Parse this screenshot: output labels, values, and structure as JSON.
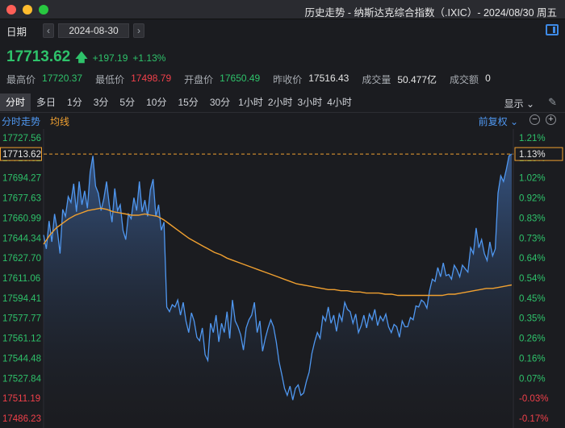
{
  "window": {
    "title": "历史走势 - 纳斯达克综合指数（.IXIC）- 2024/08/30 周五",
    "traffic_lights": [
      "#fe5f57",
      "#febc2e",
      "#28c840"
    ]
  },
  "date_bar": {
    "label": "日期",
    "prev_icon": "chevron-left-icon",
    "prev_glyph": "‹",
    "date": "2024-08-30",
    "next_icon": "chevron-right-icon",
    "next_glyph": "›",
    "panel_icon": "side-panel-icon"
  },
  "quote": {
    "price": "17713.62",
    "arrow": "🡅",
    "change": "+197.19",
    "change_pct": "+1.13%",
    "stats": [
      {
        "label": "最高价",
        "value": "17720.37",
        "color": "green"
      },
      {
        "label": "最低价",
        "value": "17498.79",
        "color": "red"
      },
      {
        "label": "开盘价",
        "value": "17650.49",
        "color": "green"
      },
      {
        "label": "昨收价",
        "value": "17516.43",
        "color": "white"
      },
      {
        "label": "成交量",
        "value": "50.477亿",
        "color": "white"
      },
      {
        "label": "成交额",
        "value": "0",
        "color": "white"
      }
    ]
  },
  "periods": {
    "tabs": [
      "分时",
      "多日",
      "1分",
      "3分",
      "5分",
      "10分",
      "15分",
      "30分",
      "1小时",
      "2小时",
      "3小时",
      "4小时"
    ],
    "active": "分时",
    "show_label": "显示",
    "show_arrow": "⌄",
    "settings_icon": "wrench-icon",
    "settings_glyph": "✎"
  },
  "chart_legend": {
    "intraday": "分时走势",
    "average": "均线",
    "adjust": "前复权",
    "adjust_arrow": "⌄",
    "zoom_out": "−",
    "zoom_in": "+"
  },
  "chart_data": {
    "type": "area",
    "y_labels_left": [
      "17727.56",
      "17713.62",
      "17694.27",
      "17677.63",
      "17660.99",
      "17644.34",
      "17627.70",
      "17611.06",
      "17594.41",
      "17577.77",
      "17561.12",
      "17544.48",
      "17527.84",
      "17511.19",
      "17486.23"
    ],
    "y_labels_right": [
      "1.21%",
      "1.13%",
      "1.02%",
      "0.92%",
      "0.83%",
      "0.73%",
      "0.64%",
      "0.54%",
      "0.45%",
      "0.35%",
      "0.26%",
      "0.16%",
      "0.07%",
      "-0.03%",
      "-0.17%"
    ],
    "y_left_range": [
      17486.23,
      17727.56
    ],
    "y_right_range": [
      -0.17,
      1.21
    ],
    "prev_close": 17516.43,
    "current": 17713.62,
    "current_pct": "1.13%",
    "colors": {
      "price_line": "#4f97f0",
      "avg_line": "#f0a030",
      "up": "#2ec26a",
      "down": "#f0404a",
      "current_marker": "#f0a030"
    },
    "series": [
      {
        "name": "分时走势",
        "values": [
          17644,
          17632,
          17656,
          17638,
          17662,
          17648,
          17628,
          17666,
          17660,
          17677,
          17672,
          17688,
          17664,
          17690,
          17670,
          17682,
          17667,
          17698,
          17712,
          17686,
          17680,
          17665,
          17675,
          17690,
          17670,
          17655,
          17684,
          17665,
          17670,
          17648,
          17640,
          17662,
          17658,
          17676,
          17665,
          17690,
          17664,
          17674,
          17660,
          17683,
          17692,
          17660,
          17670,
          17648,
          17655,
          17582,
          17578,
          17584,
          17582,
          17588,
          17575,
          17586,
          17570,
          17560,
          17577,
          17570,
          17556,
          17553,
          17564,
          17541,
          17536,
          17568,
          17560,
          17575,
          17552,
          17568,
          17560,
          17578,
          17555,
          17588,
          17570,
          17565,
          17558,
          17545,
          17564,
          17571,
          17575,
          17586,
          17560,
          17570,
          17544,
          17555,
          17564,
          17571,
          17565,
          17552,
          17535,
          17524,
          17512,
          17506,
          17514,
          17502,
          17512,
          17515,
          17506,
          17508,
          17518,
          17526,
          17542,
          17552,
          17560,
          17555,
          17574,
          17570,
          17582,
          17568,
          17575,
          17561,
          17576,
          17570,
          17586,
          17580,
          17578,
          17568,
          17576,
          17560,
          17566,
          17575,
          17564,
          17576,
          17571,
          17580,
          17566,
          17574,
          17570,
          17576,
          17565,
          17560,
          17567,
          17565,
          17556,
          17570,
          17565,
          17565,
          17573,
          17571,
          17583,
          17582,
          17588,
          17586,
          17581,
          17596,
          17606,
          17604,
          17616,
          17608,
          17620,
          17609,
          17610,
          17606,
          17618,
          17614,
          17608,
          17618,
          17615,
          17612,
          17633,
          17628,
          17650,
          17633,
          17640,
          17628,
          17622,
          17638,
          17626,
          17632,
          17680,
          17695,
          17690,
          17700,
          17712,
          17713.62
        ]
      },
      {
        "name": "均线",
        "values": [
          17636,
          17644,
          17650,
          17654,
          17658,
          17661,
          17663,
          17665,
          17666,
          17667,
          17666,
          17664,
          17663,
          17662,
          17661,
          17661,
          17662,
          17661,
          17660,
          17657,
          17653,
          17649,
          17645,
          17641,
          17638,
          17635,
          17632,
          17629,
          17627,
          17624,
          17622,
          17620,
          17618,
          17616,
          17614,
          17612,
          17610,
          17608,
          17606,
          17604,
          17602,
          17601,
          17600,
          17599,
          17598,
          17597,
          17597,
          17596,
          17596,
          17595,
          17595,
          17594,
          17594,
          17594,
          17593,
          17593,
          17592,
          17592,
          17592,
          17592,
          17592,
          17592,
          17592,
          17592,
          17593,
          17593,
          17594,
          17595,
          17596,
          17597,
          17598,
          17598,
          17599,
          17600,
          17601
        ]
      }
    ]
  }
}
